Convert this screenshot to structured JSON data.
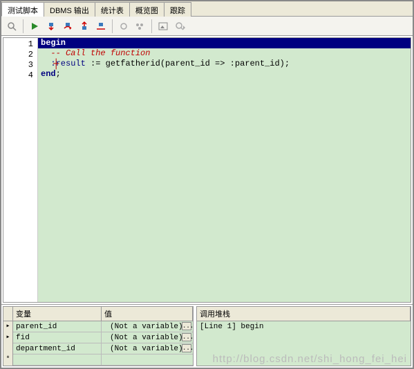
{
  "tabs": {
    "t0": "测试脚本",
    "t1": "DBMS 输出",
    "t2": "统计表",
    "t3": "概览图",
    "t4": "跟踪"
  },
  "gutter": {
    "l1": "1",
    "l2": "2",
    "l3": "3",
    "l4": "4"
  },
  "code": {
    "l1": "begin",
    "l2_pre": "  ",
    "l2_cmt": "-- Call the function",
    "l3_pre": "  ",
    "l3_a": ":result",
    " l3_b": " := getfatherid(parent_id => :parent_id);",
    "l4": "end",
    "l4_b": ";"
  },
  "vars": {
    "header_var": "变量",
    "header_val": "值",
    "r1_name": "parent_id",
    "r1_val": "(Not a variable)",
    "r2_name": "fid",
    "r2_val": "(Not a variable)",
    "r3_name": "department_id",
    "r3_val": "(Not a variable)",
    "star": "*",
    "dots": "..."
  },
  "stack": {
    "header": "调用堆栈",
    "r1": "[Line 1] begin"
  },
  "watermark": "http://blog.csdn.net/shi_hong_fei_hei",
  "icons": {
    "search": "search-icon",
    "run": "run-icon",
    "step_into": "step-into-icon",
    "step_over": "step-over-icon",
    "step_out": "step-out-icon",
    "run_to": "run-to-icon",
    "break": "break-icon",
    "threads": "threads-icon",
    "image": "image-icon",
    "zoom": "zoom-icon"
  }
}
